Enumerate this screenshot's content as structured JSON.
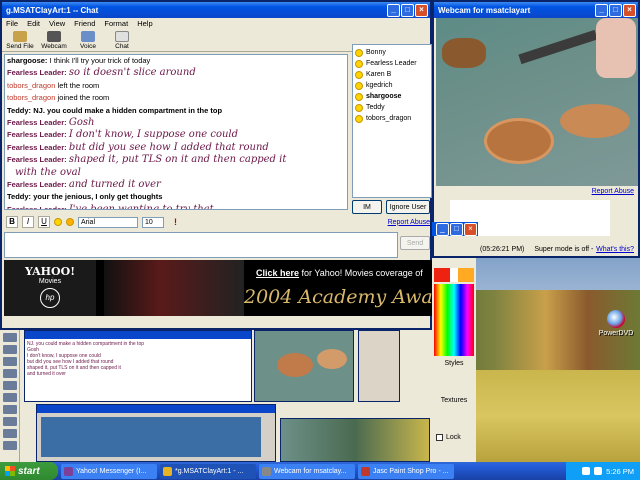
{
  "desktop": {
    "icon_label": "PowerDVD"
  },
  "chat": {
    "title": "g.MSATClayArt:1 -- Chat",
    "menu": [
      "File",
      "Edit",
      "View",
      "Friend",
      "Format",
      "Help"
    ],
    "toolbar": [
      "Send File",
      "Webcam",
      "Voice",
      "Chat"
    ],
    "lines": [
      {
        "name": "shargoose:",
        "text": "I think I'll try your trick of today",
        "kind": "sys"
      },
      {
        "name": "Fearless Leader:",
        "text": "so it doesn't slice around",
        "kind": "msg"
      },
      {
        "name": "tobors_dragon",
        "text": "left the room",
        "kind": "left"
      },
      {
        "name": "tobors_dragon",
        "text": "joined the room",
        "kind": "left"
      },
      {
        "name": "Teddy:",
        "text": "NJ. you could make a hidden compartment in the top",
        "kind": "bold"
      },
      {
        "name": "Fearless Leader:",
        "text": "Gosh",
        "kind": "msg"
      },
      {
        "name": "Fearless Leader:",
        "text": "I don't know, I suppose one could",
        "kind": "msg"
      },
      {
        "name": "Fearless Leader:",
        "text": "but did you see how I added that round",
        "kind": "msg"
      },
      {
        "name": "Fearless Leader:",
        "text": "shaped it, put TLS on it and then capped it",
        "kind": "msg"
      },
      {
        "name": "",
        "text": "with the oval",
        "kind": "msg"
      },
      {
        "name": "Fearless Leader:",
        "text": "and turned it over",
        "kind": "msg"
      },
      {
        "name": "Teddy:",
        "text": "your the jenious, I only get thoughts",
        "kind": "bold"
      },
      {
        "name": "Fearless Leader:",
        "text": "I've been wanting to try that",
        "kind": "msg"
      }
    ],
    "users": [
      "Bonny",
      "Fearless Leader",
      "Karen B",
      "kgedrich",
      "shargoose",
      "Teddy",
      "tobors_dragon"
    ],
    "im_button": "IM",
    "ignore_button": "Ignore User",
    "report_abuse": "Report Abuse",
    "font_name": "Arial",
    "font_size": "10",
    "send_button": "Send",
    "format_buttons": [
      "B",
      "I",
      "U"
    ]
  },
  "ad": {
    "logo_line1": "YAHOO!",
    "logo_line2": "Movies",
    "hp": "hp",
    "click_prefix": "Click here",
    "click_rest": " for Yahoo! Movies coverage of",
    "big_text": "2004 Academy Awa"
  },
  "webcam": {
    "title": "Webcam for msatclayart",
    "report_abuse": "Report Abuse",
    "timestamp": "(05:26:21 PM)",
    "super_mode": "Super mode is off -",
    "whats_this": "What's this?"
  },
  "psp": {
    "styles_label": "Styles",
    "textures_label": "Textures",
    "lock_label": "Lock"
  },
  "taskbar": {
    "start": "start",
    "tasks": [
      {
        "label": "Yahoo! Messenger (I...",
        "color": "#7d3f98"
      },
      {
        "label": "*g.MSATClayArt:1 - ...",
        "color": "#e6b422"
      },
      {
        "label": "Webcam for msatclay...",
        "color": "#888888"
      },
      {
        "label": "Jasc Paint Shop Pro - ...",
        "color": "#c0392b"
      }
    ],
    "clock": "5:26 PM"
  },
  "colors": {
    "chat_msg": "#6b1748",
    "titlebar": "#0054e3"
  }
}
